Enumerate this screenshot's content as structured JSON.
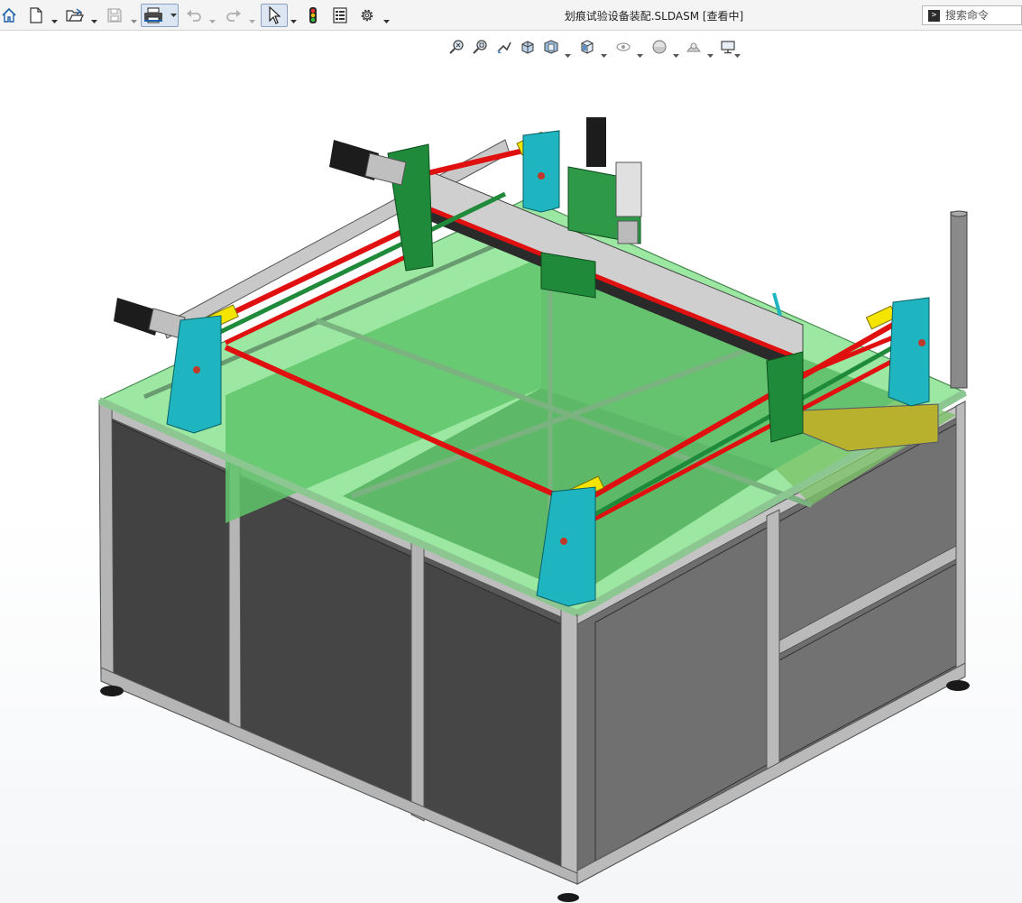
{
  "window": {
    "title": "划痕试验设备装配.SLDASM [查看中]"
  },
  "search": {
    "placeholder": "搜索命令"
  },
  "toolbar": {
    "buttons": [
      {
        "icon": "home-icon"
      },
      {
        "icon": "new-document-icon"
      },
      {
        "icon": "open-folder-icon"
      },
      {
        "icon": "save-icon"
      },
      {
        "icon": "print-icon"
      },
      {
        "icon": "undo-icon"
      },
      {
        "icon": "redo-icon"
      },
      {
        "icon": "select-cursor-icon"
      },
      {
        "icon": "traffic-light-icon"
      },
      {
        "icon": "file-properties-icon"
      },
      {
        "icon": "options-gear-icon"
      }
    ]
  },
  "heads_up_toolbar": {
    "buttons": [
      {
        "icon": "zoom-to-fit-icon"
      },
      {
        "icon": "zoom-to-area-icon"
      },
      {
        "icon": "previous-view-icon"
      },
      {
        "icon": "section-view-icon"
      },
      {
        "icon": "view-orientation-icon"
      },
      {
        "icon": "display-style-icon"
      },
      {
        "icon": "hide-show-items-icon"
      },
      {
        "icon": "edit-appearance-icon"
      },
      {
        "icon": "apply-scene-icon"
      },
      {
        "icon": "view-settings-icon"
      }
    ]
  },
  "colors": {
    "frame_panel": "#6e6e6e",
    "frame_rail": "#b8b8b8",
    "glass_green": "#7fe08a",
    "gantry_green": "#1f8a3a",
    "rod_red": "#e01010",
    "bracket_cyan": "#1fb5c0",
    "bumper_yellow": "#f5e400",
    "motor_black": "#1c1c1c"
  }
}
